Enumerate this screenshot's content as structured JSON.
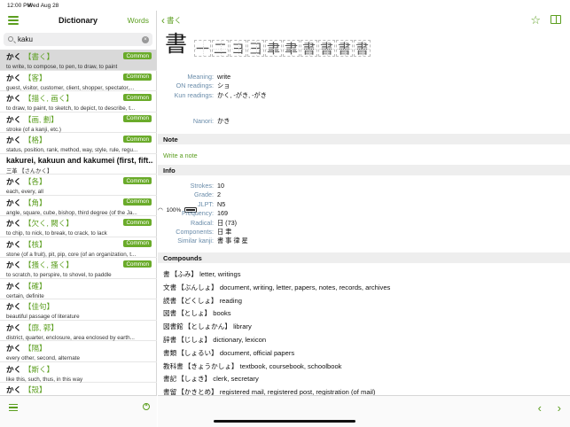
{
  "status": {
    "time": "12:00 PM",
    "date": "Wed Aug 28",
    "battery": "100%"
  },
  "left": {
    "title": "Dictionary",
    "words_label": "Words",
    "search_value": "kaku",
    "results": [
      {
        "reading": "かく",
        "kanji": "【書く】",
        "def": "to write, to compose, to pen, to draw, to paint",
        "badge": "Common",
        "selected": true
      },
      {
        "reading": "かく",
        "kanji": "【客】",
        "def": "guest, visitor, customer, client, shopper, spectator,...",
        "badge": "Common"
      },
      {
        "reading": "かく",
        "kanji": "【描く, 画く】",
        "def": "to draw, to paint, to sketch, to depict, to describe, t...",
        "badge": "Common"
      },
      {
        "reading": "かく",
        "kanji": "【画, 劃】",
        "def": "stroke (of a kanji, etc.)",
        "badge": "Common"
      },
      {
        "reading": "かく",
        "kanji": "【格】",
        "def": "status, position, rank, method, way, style, rule, regu...",
        "badge": "Common"
      },
      {
        "reading": "kakurei, kakuun and kakumei (first, fift...",
        "kanji": "",
        "def": "三革 【さんかく】",
        "badge": "",
        "big": true
      },
      {
        "reading": "かく",
        "kanji": "【各】",
        "def": "each, every, all",
        "badge": "Common"
      },
      {
        "reading": "かく",
        "kanji": "【角】",
        "def": "angle, square, cube, bishop, third degree (of the Ja...",
        "badge": "Common"
      },
      {
        "reading": "かく",
        "kanji": "【欠く, 闕く】",
        "def": "to chip, to nick, to break, to crack, to lack",
        "badge": "Common"
      },
      {
        "reading": "かく",
        "kanji": "【核】",
        "def": "stone (of a fruit), pit, pip, core (of an organization, t...",
        "badge": "Common"
      },
      {
        "reading": "かく",
        "kanji": "【掻く, 搔く】",
        "def": "to scratch, to perspire, to shovel, to paddle",
        "badge": "Common"
      },
      {
        "reading": "かく",
        "kanji": "【確】",
        "def": "certain, definite",
        "badge": ""
      },
      {
        "reading": "かく",
        "kanji": "【佳句】",
        "def": "beautiful passage of literature",
        "badge": ""
      },
      {
        "reading": "かく",
        "kanji": "【廓, 郭】",
        "def": "district, quarter, enclosure, area enclosed by earth...",
        "badge": ""
      },
      {
        "reading": "かく",
        "kanji": "【隔】",
        "def": "every other, second, alternate",
        "badge": ""
      },
      {
        "reading": "かく",
        "kanji": "【斯く】",
        "def": "like this, such, thus, in this way",
        "badge": ""
      },
      {
        "reading": "かく",
        "kanji": "【殻】",
        "def": "",
        "badge": ""
      }
    ]
  },
  "right": {
    "back_label": "書く",
    "kanji": "書",
    "stroke_frames": [
      "⼀",
      "二",
      "ヨ",
      "彐",
      "聿",
      "聿",
      "書",
      "書",
      "書",
      "書"
    ],
    "meaning_label": "Meaning:",
    "meaning": "write",
    "on_label": "ON readings:",
    "on": "ショ",
    "kun_label": "Kun readings:",
    "kun": "かく, -がき, -がき",
    "nanori_label": "Nanori:",
    "nanori": "かき",
    "note_title": "Note",
    "note_link": "Write a note",
    "info_title": "Info",
    "info": [
      {
        "k": "Strokes:",
        "v": "10"
      },
      {
        "k": "Grade:",
        "v": "2"
      },
      {
        "k": "JLPT:",
        "v": "N5"
      },
      {
        "k": "Frequency:",
        "v": "169"
      },
      {
        "k": "Radical:",
        "v": "日 (73)"
      },
      {
        "k": "Components:",
        "v": "日 聿"
      },
      {
        "k": "Similar kanji:",
        "v": "書 事 律 星"
      }
    ],
    "compounds_title": "Compounds",
    "compounds": [
      {
        "w": "書",
        "r": "【ふみ】",
        "d": "letter, writings"
      },
      {
        "w": "文書",
        "r": "【ぶんしょ】",
        "d": "document, writing, letter, papers, notes, records, archives"
      },
      {
        "w": "読書",
        "r": "【どくしょ】",
        "d": "reading"
      },
      {
        "w": "図書",
        "r": "【としょ】",
        "d": "books"
      },
      {
        "w": "図書館",
        "r": "【としょかん】",
        "d": "library"
      },
      {
        "w": "辞書",
        "r": "【じしょ】",
        "d": "dictionary, lexicon"
      },
      {
        "w": "書類",
        "r": "【しょるい】",
        "d": "document, official papers"
      },
      {
        "w": "教科書",
        "r": "【きょうかしょ】",
        "d": "textbook, coursebook, schoolbook"
      },
      {
        "w": "書記",
        "r": "【しょき】",
        "d": "clerk, secretary"
      },
      {
        "w": "書留",
        "r": "【かきとめ】",
        "d": "registered mail, registered post, registration (of mail)"
      }
    ]
  },
  "colors": {
    "accent": "#5b9e1f",
    "badge": "#6aab2a",
    "label": "#6a8caa"
  }
}
